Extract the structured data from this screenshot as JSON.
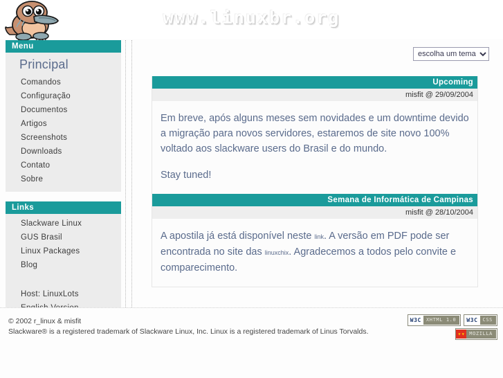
{
  "header": {
    "site_title": "www.linuxbr.org",
    "logo_alt": "platypus-mascot"
  },
  "sidebar": {
    "menu_panel": {
      "title": "Menu",
      "main_item": "Principal",
      "items": [
        {
          "label": "Comandos"
        },
        {
          "label": "Configuração"
        },
        {
          "label": "Documentos"
        },
        {
          "label": "Artigos"
        },
        {
          "label": "Screenshots"
        },
        {
          "label": "Downloads"
        },
        {
          "label": "Contato"
        },
        {
          "label": "Sobre"
        }
      ]
    },
    "links_panel": {
      "title": "Links",
      "items": [
        {
          "label": "Slackware Linux"
        },
        {
          "label": "GUS Brasil"
        },
        {
          "label": "Linux Packages"
        },
        {
          "label": "Blog"
        }
      ],
      "extra_items": [
        {
          "label": "Host: LinuxLots"
        },
        {
          "label": "English Version"
        }
      ]
    }
  },
  "main": {
    "theme_select": {
      "selected": "escolha um tema...",
      "options": [
        "escolha um tema..."
      ]
    },
    "news": [
      {
        "title": "Upcoming",
        "meta": "misfit @ 29/09/2004",
        "paragraphs": [
          "Em breve, após alguns meses sem novidades e um downtime devido a migração para novos servidores, estaremos de site novo 100% voltado aos slackware users do Brasil e do mundo.",
          "Stay tuned!"
        ]
      },
      {
        "title": "Semana de Informática de Campinas",
        "meta": "misfit @ 28/10/2004",
        "segments": [
          {
            "text": "A apostila já está disponível neste ",
            "link": false
          },
          {
            "text": "link",
            "link": true
          },
          {
            "text": ". A versão em PDF pode ser encontrada no site das ",
            "link": false
          },
          {
            "text": "linuxchix",
            "link": true
          },
          {
            "text": ". Agradecemos a todos pelo convite e comparecimento.",
            "link": false
          }
        ]
      }
    ]
  },
  "footer": {
    "copyright": "© 2002 r_linux & misfit",
    "trademark": "Slackware® is a registered trademark of Slackware Linux, Inc. Linux is a registered trademark of Linus Torvalds.",
    "badges": [
      {
        "mark": "W3C",
        "label": "XHTML 1.0",
        "kind": "w3c"
      },
      {
        "mark": "W3C",
        "label": "CSS",
        "kind": "w3c"
      },
      {
        "mark": "",
        "label": "MOZILLA",
        "kind": "mozilla"
      }
    ]
  },
  "colors": {
    "accent_teal": "#1a9b9b",
    "text_blue": "#5a6b8c",
    "panel_bg": "#ececec",
    "meta_bg": "#eeeeee"
  }
}
